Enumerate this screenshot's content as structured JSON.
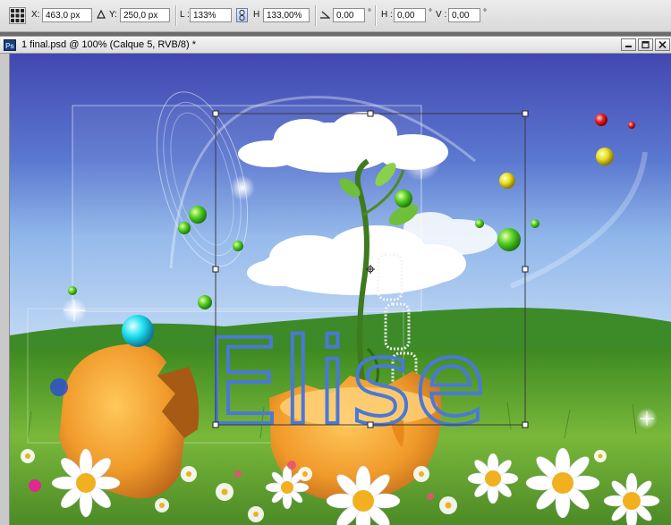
{
  "options_bar": {
    "x_label": "X:",
    "x_value": "463,0 px",
    "y_label": "Y:",
    "y_value": "250,0 px",
    "w_label": "L :",
    "w_value": "133%",
    "h_label": "H :",
    "h_value": "133,00%",
    "angle_value": "0,00",
    "angle_unit": "°",
    "skew_h_label": "H :",
    "skew_h_value": "0,00",
    "skew_h_unit": "°",
    "skew_v_label": "V :",
    "skew_v_value": "0,00",
    "skew_v_unit": "°"
  },
  "document": {
    "app_icon": "Ps",
    "title": "1 final.psd @ 100% (Calque 5, RVB/8) *",
    "overlay_text": "Elise"
  },
  "icons": [
    "reference-point-icon",
    "delta-icon",
    "link-icon",
    "angle-icon",
    "minimize-icon",
    "maximize-icon",
    "close-icon"
  ],
  "colors": {
    "sky_top": "#4a56b8",
    "grass": "#4c9a2a",
    "text_blue": "#4a78d8",
    "egg": "#e9962a"
  }
}
